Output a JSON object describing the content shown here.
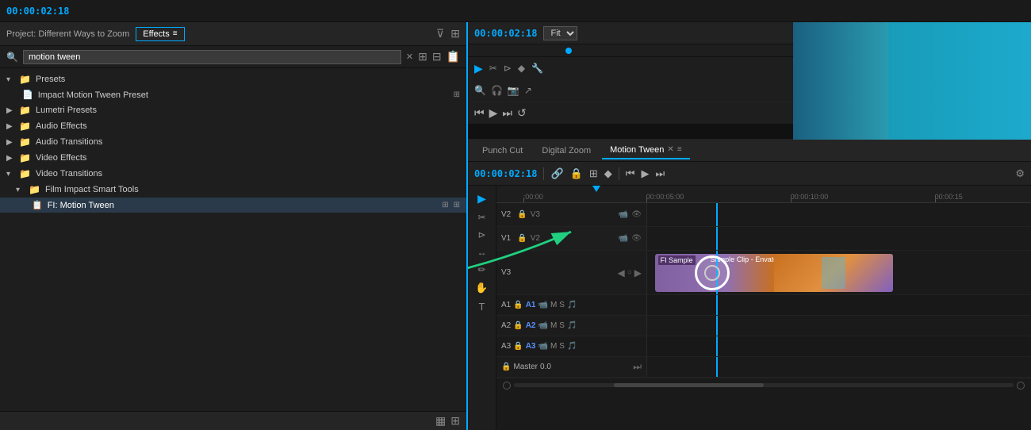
{
  "leftPanel": {
    "projectLabel": "Project: Different Ways to Zoom",
    "effectsTab": "Effects",
    "searchPlaceholder": "motion tween",
    "searchValue": "motion tween",
    "categories": [
      {
        "id": "presets",
        "level": 0,
        "type": "folder",
        "label": "Presets",
        "expanded": true,
        "arrow": "▾"
      },
      {
        "id": "impact-motion-tween",
        "level": 1,
        "type": "file",
        "label": "Impact Motion Tween Preset",
        "badge": "⊞"
      },
      {
        "id": "lumetri",
        "level": 0,
        "type": "folder",
        "label": "Lumetri Presets",
        "arrow": "▶"
      },
      {
        "id": "audio-effects",
        "level": 0,
        "type": "folder",
        "label": "Audio Effects",
        "arrow": "▶"
      },
      {
        "id": "audio-transitions",
        "level": 0,
        "type": "folder",
        "label": "Audio Transitions",
        "arrow": "▶"
      },
      {
        "id": "video-effects",
        "level": 0,
        "type": "folder",
        "label": "Video Effects",
        "arrow": "▶"
      },
      {
        "id": "video-transitions",
        "level": 0,
        "type": "folder",
        "label": "Video Transitions",
        "expanded": true,
        "arrow": "▾"
      },
      {
        "id": "film-impact",
        "level": 1,
        "type": "folder",
        "label": "Film Impact Smart Tools",
        "expanded": true,
        "arrow": "▾"
      },
      {
        "id": "fi-motion-tween",
        "level": 2,
        "type": "special",
        "label": "FI: Motion Tween",
        "selected": true,
        "badges": [
          "⊞",
          "⊞"
        ]
      }
    ],
    "footerIcons": [
      "▦",
      "⊞"
    ]
  },
  "previewPanel": {
    "timecode": "00:00:02:18",
    "fitLabel": "Fit",
    "timecodeLeft": "00:00:02:18"
  },
  "timeline": {
    "tabs": [
      {
        "label": "Punch Cut",
        "active": false
      },
      {
        "label": "Digital Zoom",
        "active": false
      },
      {
        "label": "Motion Tween",
        "active": true,
        "closeable": true
      }
    ],
    "timecode": "00:00:02:18",
    "rulerMarks": [
      {
        "label": ":00:00",
        "pct": 5
      },
      {
        "label": "00:00:05:00",
        "pct": 30
      },
      {
        "label": "00:00:10:00",
        "pct": 58
      },
      {
        "label": "00:00:15",
        "pct": 85
      }
    ],
    "tracks": [
      {
        "name": "V2",
        "lock": true,
        "controls": [
          "V3",
          "🔒",
          "📹",
          "👁"
        ],
        "hasClip": false
      },
      {
        "name": "V1",
        "lock": true,
        "controls": [
          "V2",
          "🔒",
          "📹",
          "👁"
        ],
        "hasClip": false
      },
      {
        "name": "",
        "controls": [],
        "hasClip": true,
        "clipLabel": "FI Sample / Sample Clip - Envato Elements",
        "clipStart": 5,
        "clipWidth": 60
      }
    ],
    "audioTracks": [
      {
        "name": "A1",
        "label": "A1",
        "m": "M",
        "s": "S"
      },
      {
        "name": "A2",
        "label": "A2",
        "m": "M",
        "s": "S"
      },
      {
        "name": "A3",
        "label": "A3",
        "m": "M",
        "s": "S"
      },
      {
        "name": "Master",
        "val": "0.0"
      }
    ],
    "playheadPct": 18
  },
  "colors": {
    "accent": "#00aaff",
    "arrowGreen": "#20d080",
    "clipGradientStart": "#c87020",
    "clipGradientEnd": "#8060c0"
  }
}
